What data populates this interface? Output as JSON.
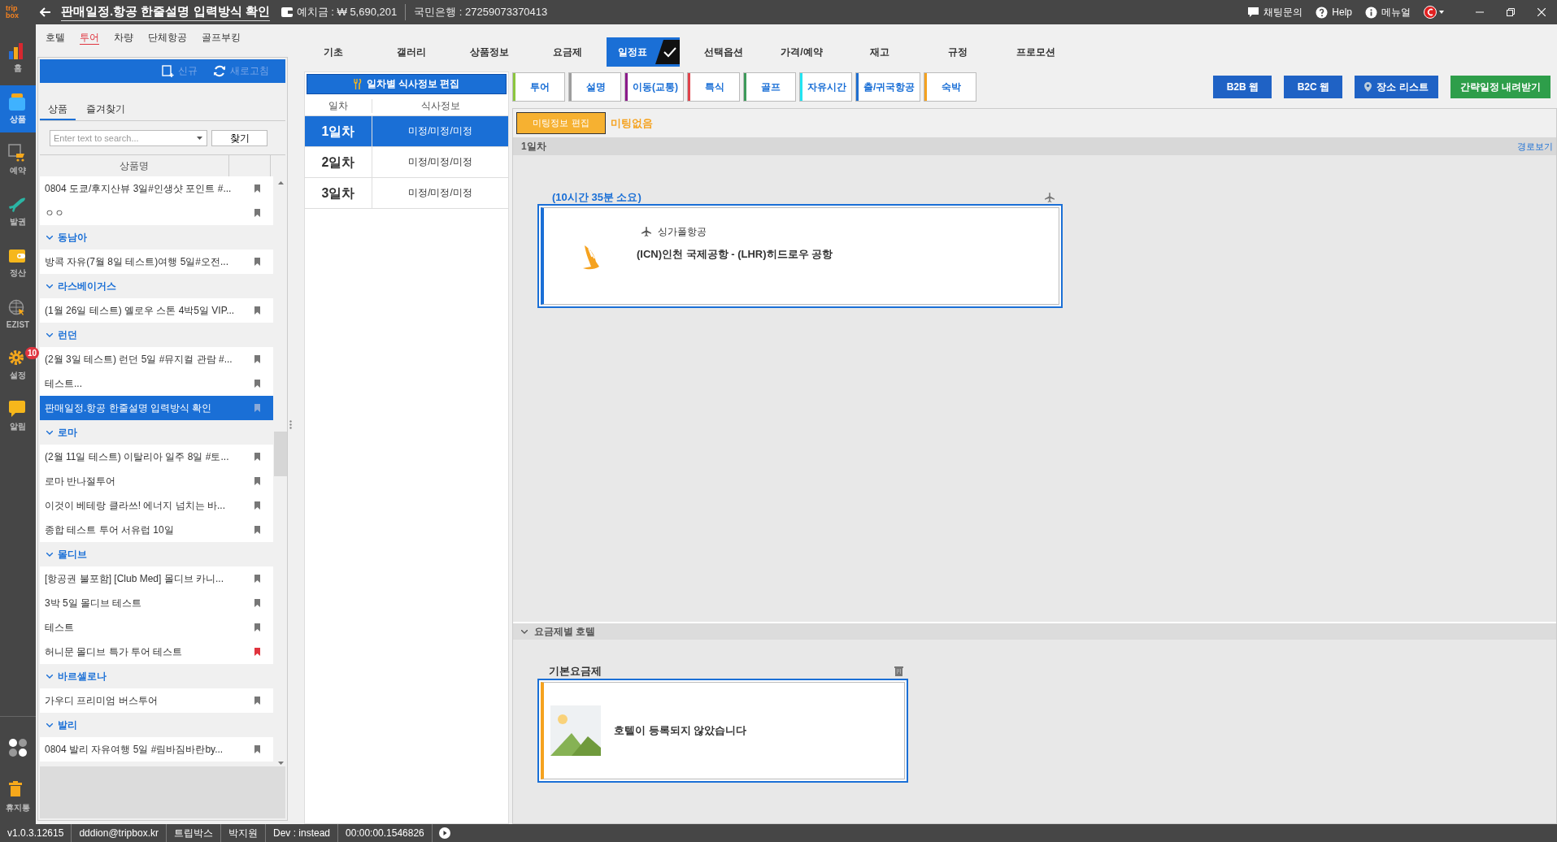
{
  "title_bar": {
    "logo": "trip box",
    "title": "판매일정.항공 한줄설명 입력방식 확인",
    "deposit": "예치금 : ₩ 5,690,201",
    "bank": "국민은행 : 27259073370413",
    "links": [
      {
        "kind": "chat",
        "label": "채팅문의"
      },
      {
        "kind": "help",
        "label": "Help"
      },
      {
        "kind": "info",
        "label": "메뉴얼"
      }
    ]
  },
  "rail": [
    {
      "kind": "chart",
      "label": "홈",
      "selected": false
    },
    {
      "kind": "box",
      "label": "상품",
      "selected": true
    },
    {
      "kind": "cart",
      "label": "예약",
      "selected": false
    },
    {
      "kind": "plane",
      "label": "발권",
      "selected": false
    },
    {
      "kind": "wallet",
      "label": "정산",
      "selected": false
    },
    {
      "kind": "globe",
      "label": "EZIST",
      "selected": false
    },
    {
      "kind": "gear",
      "label": "설정",
      "selected": false,
      "badge": "10"
    },
    {
      "kind": "bubble",
      "label": "알림",
      "selected": false
    }
  ],
  "rail_bottom": [
    {
      "kind": "apps"
    },
    {
      "kind": "trash",
      "label": "휴지통"
    }
  ],
  "module_tabs": [
    {
      "label": "호텔",
      "selected": false
    },
    {
      "label": "투어",
      "selected": true
    },
    {
      "label": "차량",
      "selected": false
    },
    {
      "label": "단체항공",
      "selected": false
    },
    {
      "label": "골프부킹",
      "selected": false
    }
  ],
  "toolbar": [
    {
      "kind": "new",
      "label": "신규",
      "disabled": true
    },
    {
      "kind": "refresh",
      "label": "새로고침",
      "disabled": true
    }
  ],
  "list_tabs": [
    {
      "label": "상품",
      "selected": true
    },
    {
      "label": "즐겨찾기",
      "selected": false
    }
  ],
  "search": {
    "placeholder": "Enter text to search...",
    "button": "찾기"
  },
  "product_list": {
    "column": "상품명",
    "rows": [
      {
        "kind": "item",
        "label": "0804 도쿄/후지산뷰 3일#인생샷 포인트 #...",
        "bookmarked": false,
        "selected": false
      },
      {
        "kind": "item",
        "label": "ㅇㅇ",
        "bookmarked": false,
        "selected": false
      },
      {
        "kind": "group",
        "label": "동남아",
        "expanded": true
      },
      {
        "kind": "item",
        "label": "방콕 자유(7월 8일 테스트)여행 5일#오전...",
        "bookmarked": false,
        "selected": false
      },
      {
        "kind": "group",
        "label": "라스베이거스",
        "expanded": true
      },
      {
        "kind": "item",
        "label": "(1월 26일 테스트) 옐로우 스톤 4박5일 VIP...",
        "bookmarked": false,
        "selected": false
      },
      {
        "kind": "group",
        "label": "런던",
        "expanded": true
      },
      {
        "kind": "item",
        "label": "(2월 3일 테스트) 런던 5일 #뮤지컬 관람 #...",
        "bookmarked": false,
        "selected": false
      },
      {
        "kind": "item",
        "label": "테스트...",
        "bookmarked": false,
        "selected": false
      },
      {
        "kind": "item",
        "label": "판매일정.항공 한줄설명 입력방식 확인",
        "bookmarked": false,
        "selected": true
      },
      {
        "kind": "group",
        "label": "로마",
        "expanded": true
      },
      {
        "kind": "item",
        "label": "(2월 11일 테스트) 이탈리아 일주 8일 #토...",
        "bookmarked": false,
        "selected": false
      },
      {
        "kind": "item",
        "label": "로마 반나절투어",
        "bookmarked": false,
        "selected": false
      },
      {
        "kind": "item",
        "label": "이것이 베테랑 클라쓰! 에너지 넘치는 바...",
        "bookmarked": false,
        "selected": false
      },
      {
        "kind": "item",
        "label": "종합 테스트 투어 서유럽 10일",
        "bookmarked": false,
        "selected": false
      },
      {
        "kind": "group",
        "label": "몰디브",
        "expanded": true
      },
      {
        "kind": "item",
        "label": "[항공권 불포함] [Club Med] 몰디브 카니...",
        "bookmarked": false,
        "selected": false
      },
      {
        "kind": "item",
        "label": "3박 5일 몰디브 테스트",
        "bookmarked": false,
        "selected": false
      },
      {
        "kind": "item",
        "label": "테스트",
        "bookmarked": false,
        "selected": false
      },
      {
        "kind": "item",
        "label": "허니문 몰디브 특가 투어 테스트",
        "bookmarked": true,
        "selected": false
      },
      {
        "kind": "group",
        "label": "바르셀로나",
        "expanded": true
      },
      {
        "kind": "item",
        "label": "가우디 프리미엄 버스투어",
        "bookmarked": false,
        "selected": false
      },
      {
        "kind": "group",
        "label": "발리",
        "expanded": true
      },
      {
        "kind": "item",
        "label": "0804 발리 자유여행 5일 #림바짐바란by...",
        "bookmarked": false,
        "selected": false
      }
    ]
  },
  "section_tabs": [
    {
      "label": "기초",
      "selected": false,
      "checked": false
    },
    {
      "label": "갤러리",
      "selected": false,
      "checked": false
    },
    {
      "label": "상품정보",
      "selected": false,
      "checked": false
    },
    {
      "label": "요금제",
      "selected": false,
      "checked": false
    },
    {
      "label": "일정표",
      "selected": true,
      "checked": true
    },
    {
      "label": "선택옵션",
      "selected": false,
      "checked": false
    },
    {
      "label": "가격/예약",
      "selected": false,
      "checked": false
    },
    {
      "label": "재고",
      "selected": false,
      "checked": false
    },
    {
      "label": "규정",
      "selected": false,
      "checked": false
    },
    {
      "label": "프로모션",
      "selected": false,
      "checked": false
    }
  ],
  "meals": {
    "button": "일차별 식사정보 편집",
    "columns": [
      "일차",
      "식사정보"
    ],
    "rows": [
      {
        "day": "1일차",
        "meals": "미정/미정/미정",
        "selected": true
      },
      {
        "day": "2일차",
        "meals": "미정/미정/미정",
        "selected": false
      },
      {
        "day": "3일차",
        "meals": "미정/미정/미정",
        "selected": false
      }
    ]
  },
  "categories": [
    {
      "label": "투어",
      "color": "#8cc63e"
    },
    {
      "label": "설명",
      "color": "#9e9e9e"
    },
    {
      "label": "이동(교통)",
      "color": "#8b1a8b"
    },
    {
      "label": "특식",
      "color": "#e0434b"
    },
    {
      "label": "골프",
      "color": "#3d9a5a"
    },
    {
      "label": "자유시간",
      "color": "#22e4f2"
    },
    {
      "label": "출/귀국항공",
      "color": "#1f6fd0"
    },
    {
      "label": "숙박",
      "color": "#f5a21f"
    }
  ],
  "actions": [
    {
      "kind": "blue",
      "label": "B2B 웹"
    },
    {
      "kind": "blue",
      "label": "B2C 웹"
    },
    {
      "kind": "place",
      "label": "장소 리스트"
    },
    {
      "kind": "green",
      "label": "간략일정 내려받기"
    }
  ],
  "meeting": {
    "button": "미팅정보 편집",
    "status": "미팅없음"
  },
  "day_bar": {
    "label": "1일차",
    "link": "경로보기"
  },
  "flight": {
    "duration": "(10시간 35분 소요)",
    "airline": "싱가폴항공",
    "route": "(ICN)인천 국제공항 - (LHR)히드로우 공항"
  },
  "hotel_section": {
    "title": "요금제별 호텔",
    "expanded": true,
    "plan": "기본요금제",
    "message": "호텔이 등록되지 않았습니다"
  },
  "status_bar": [
    "v1.0.3.12615",
    "dddion@tripbox.kr",
    "트립박스",
    "박지원",
    "Dev : instead",
    "00:00:00.1546826"
  ]
}
